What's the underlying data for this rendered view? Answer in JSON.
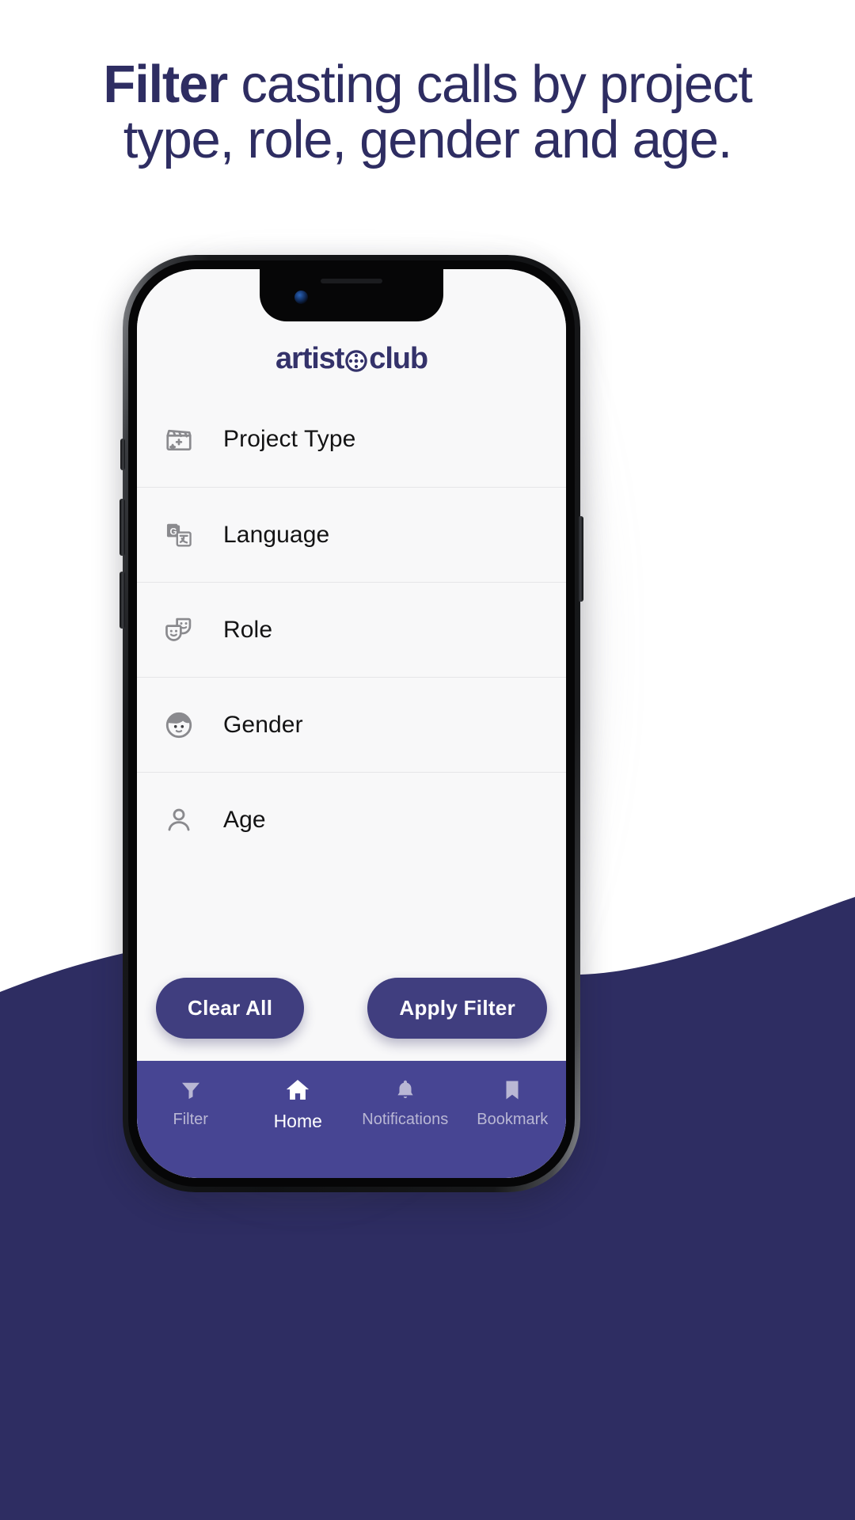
{
  "headline": {
    "bold_word": "Filter",
    "rest": " casting calls by project type, role, gender and age."
  },
  "colors": {
    "navy": "#2e2d62",
    "accent_purple": "#403e7f",
    "nav_purple": "#474593",
    "screen_bg": "#f8f8f9"
  },
  "app": {
    "logo_text": "artistoclub",
    "logo_icon": "film-reel-icon",
    "filters": [
      {
        "label": "Project Type",
        "icon": "clapperboard-icon"
      },
      {
        "label": "Language",
        "icon": "translate-icon"
      },
      {
        "label": "Role",
        "icon": "theater-masks-icon"
      },
      {
        "label": "Gender",
        "icon": "face-icon"
      },
      {
        "label": "Age",
        "icon": "person-icon"
      }
    ],
    "actions": {
      "clear_label": "Clear All",
      "apply_label": "Apply Filter"
    },
    "nav": [
      {
        "label": "Filter",
        "icon": "funnel-icon",
        "active": false
      },
      {
        "label": "Home",
        "icon": "home-icon",
        "active": true
      },
      {
        "label": "Notifications",
        "icon": "bell-icon",
        "active": false
      },
      {
        "label": "Bookmark",
        "icon": "bookmark-icon",
        "active": false
      }
    ]
  }
}
